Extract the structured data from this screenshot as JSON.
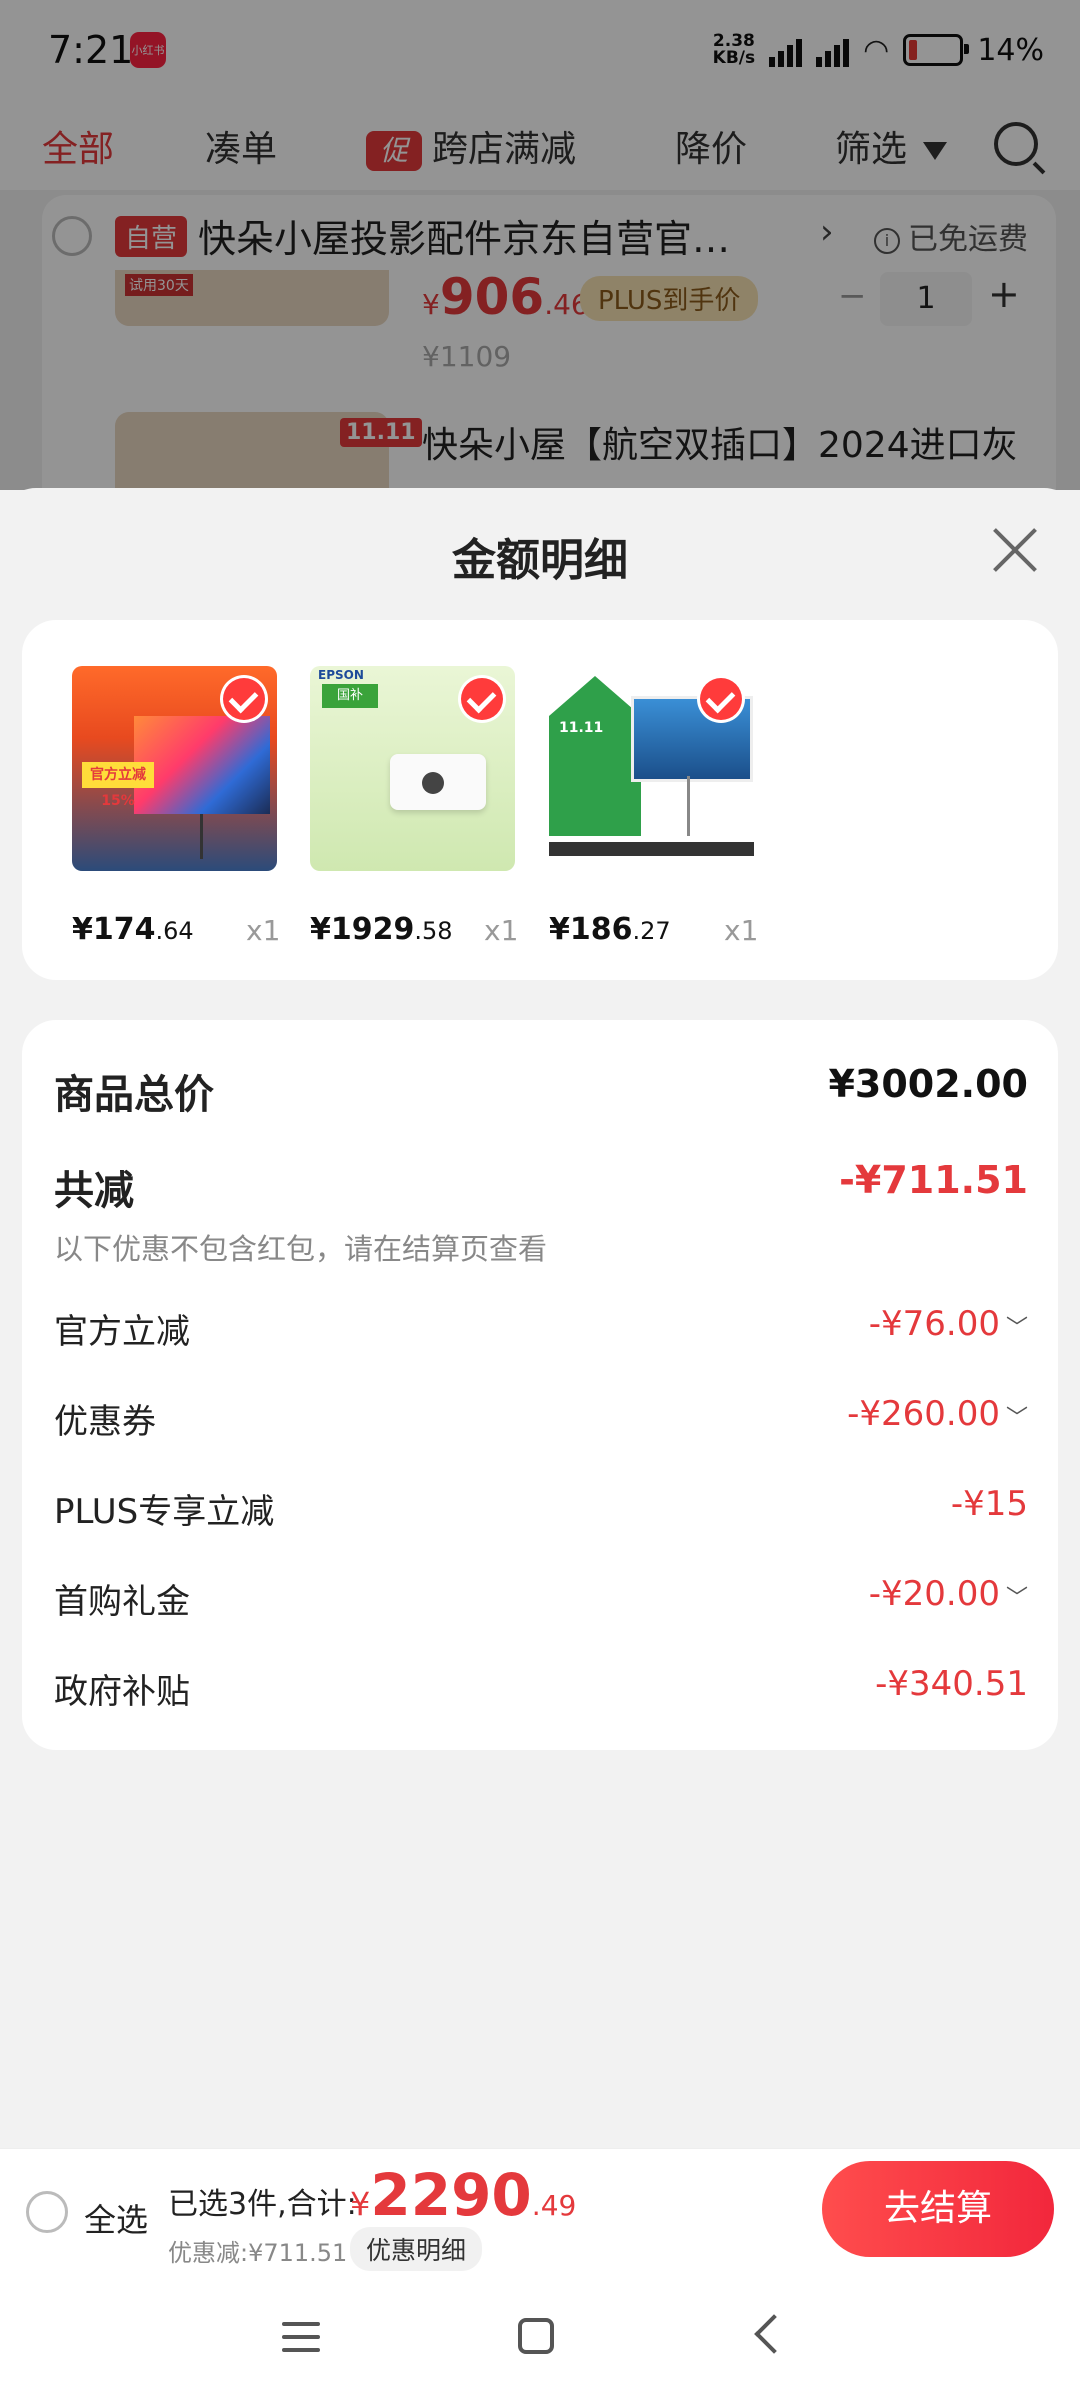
{
  "status_bar": {
    "time": "7:21",
    "app_badge": "小红书",
    "net_speed_top": "2.38",
    "net_speed_bottom": "KB/s",
    "battery": "14%"
  },
  "tabs": {
    "all": "全部",
    "bundle": "凑单",
    "promo_badge": "促",
    "cross_store": "跨店满减",
    "price_drop": "降价",
    "filter": "筛选"
  },
  "cart_bg": {
    "self_operated": "自营",
    "shop_name": "快朵小屋投影配件京东自营官…",
    "free_shipping": "已免运费",
    "thumb_label": "试用30天",
    "item1_price_int": "906",
    "item1_price_dec": ".46",
    "item1_price_cur": "¥",
    "plus_label": "PLUS到手价",
    "qty": "1",
    "orig_price": "¥1109",
    "item2_title": "快朵小屋【航空双插口】2024进口灰",
    "double11_tag": "11.11"
  },
  "sheet": {
    "title": "金额明细",
    "products": [
      {
        "price_int": "¥174",
        "price_dec": ".64",
        "qty": "x1",
        "badge": "官方立减15%"
      },
      {
        "price_int": "¥1929",
        "price_dec": ".58",
        "qty": "x1",
        "brand": "EPSON",
        "tag": "国补"
      },
      {
        "price_int": "¥186",
        "price_dec": ".27",
        "qty": "x1",
        "tag": "11.11"
      }
    ],
    "summary": {
      "total_label": "商品总价",
      "total_value": "¥3002.00",
      "reduce_label": "共减",
      "reduce_value": "-¥711.51",
      "note": "以下优惠不包含红包，请在结算页查看",
      "items": [
        {
          "label": "官方立减",
          "value": "-¥76.00"
        },
        {
          "label": "优惠券",
          "value": "-¥260.00"
        },
        {
          "label": "PLUS专享立减",
          "value": "-¥15"
        },
        {
          "label": "首购礼金",
          "value": "-¥20.00"
        },
        {
          "label": "政府补贴",
          "value": "-¥340.51"
        }
      ]
    }
  },
  "bottom_bar": {
    "select_all": "全选",
    "selected": "已选3件,合计:",
    "total_cur": "¥",
    "total_int": "2290",
    "total_dec": ".49",
    "discount": "优惠减:¥711.51",
    "detail_button": "优惠明细",
    "checkout": "去结算"
  },
  "colors": {
    "accent": "#e4393c",
    "checkout_start": "#ff4d4d",
    "checkout_end": "#f2273c"
  }
}
